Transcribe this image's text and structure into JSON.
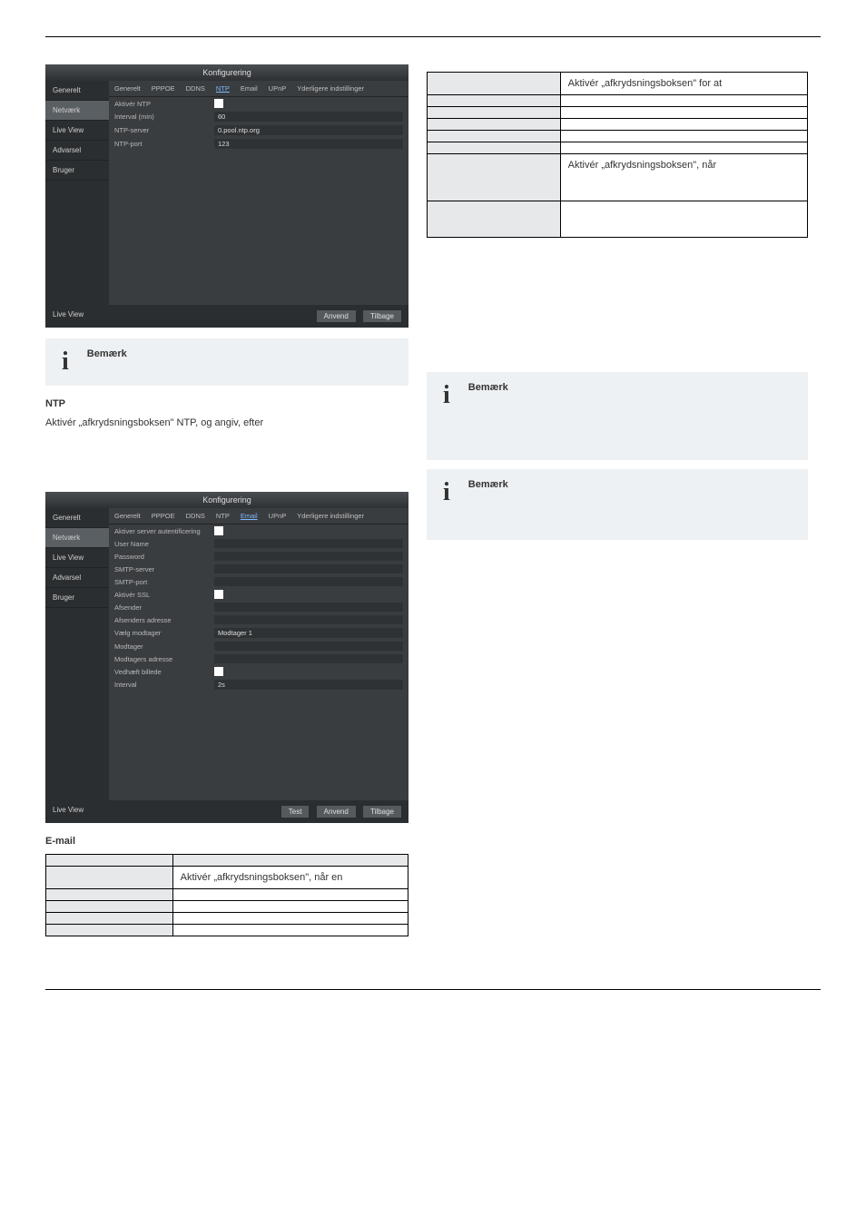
{
  "top_rule": "",
  "shot1": {
    "title": "Konfigurering",
    "side": [
      "Generelt",
      "Netværk",
      "Live View",
      "Advarsel",
      "Bruger"
    ],
    "side_selected_idx": 1,
    "tabs": [
      "Generelt",
      "PPPOE",
      "DDNS",
      "NTP",
      "Email",
      "UPnP",
      "Yderligere indstillinger"
    ],
    "tab_selected_idx": 3,
    "rows": {
      "enable_ntp_label": "Aktivér NTP",
      "interval_label": "Interval (min)",
      "interval_val": "60",
      "server_label": "NTP-server",
      "server_val": "0.pool.ntp.org",
      "port_label": "NTP-port",
      "port_val": "123"
    },
    "footer_left": "Live View",
    "btn_apply": "Anvend",
    "btn_back": "Tilbage"
  },
  "shot1_caption": "",
  "info1_head": "Bemærk",
  "info1_text": "",
  "ntp_heading": "NTP",
  "ntp_para": "Aktivér „afkrydsningsboksen\" NTP, og angiv, efter",
  "ntp_para2": "",
  "table_right": {
    "r1k": "",
    "r1v": "Aktivér „afkrydsningsboksen\" for at",
    "r2k": "",
    "r2v": "",
    "r3k": "",
    "r3v": "",
    "r4k": "",
    "r4v": "",
    "r5k": "",
    "r5v": "",
    "r6k": "",
    "r6v": "",
    "r7k": "",
    "r7v": "Aktivér „afkrydsningsboksen\", når",
    "r8k": "",
    "r8v": ""
  },
  "info2_head": "Bemærk",
  "info2_text": "",
  "info3_head": "Bemærk",
  "info3_text": "",
  "shot2": {
    "title": "Konfigurering",
    "side": [
      "Generelt",
      "Netværk",
      "Live View",
      "Advarsel",
      "Bruger"
    ],
    "side_selected_idx": 1,
    "tabs": [
      "Generelt",
      "PPPOE",
      "DDNS",
      "NTP",
      "Email",
      "UPnP",
      "Yderligere indstillinger"
    ],
    "tab_selected_idx": 4,
    "rows": {
      "auth_lbl": "Aktiver server autentificering",
      "user_lbl": "User Name",
      "pass_lbl": "Password",
      "smtp_lbl": "SMTP-server",
      "smtpport_lbl": "SMTP-port",
      "ssl_lbl": "Aktivér SSL",
      "sender_lbl": "Afsender",
      "senderaddr_lbl": "Afsenders adresse",
      "selrec_lbl": "Vælg modtager",
      "selrec_val": "Modtager 1",
      "rec_lbl": "Modtager",
      "recaddr_lbl": "Modtagers adresse",
      "attach_lbl": "Vedhæft billede",
      "interval_lbl": "Interval",
      "interval_val": "2s"
    },
    "footer_left": "Live View",
    "btn_test": "Test",
    "btn_apply": "Anvend",
    "btn_back": "Tilbage"
  },
  "email_heading": "E-mail",
  "table_email": {
    "h1": "",
    "h2": "",
    "r1k": "",
    "r1v": "Aktivér „afkrydsningsboksen\", når en",
    "r2k": "",
    "r2v": "",
    "r3k": "",
    "r3v": "",
    "r4k": "",
    "r4v": "",
    "r5k": "",
    "r5v": ""
  },
  "footer_left": "",
  "footer_right": ""
}
